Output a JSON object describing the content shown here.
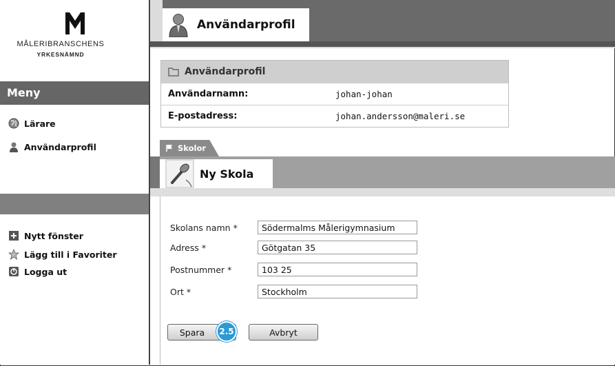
{
  "logo": {
    "line1": "MÅLERIBRANSCHENS",
    "line2": "YRKESNÄMND"
  },
  "sidebar": {
    "menu_title": "Meny",
    "items": [
      {
        "label": "Lärare",
        "icon": "globe-icon"
      },
      {
        "label": "Användarprofil",
        "icon": "user-icon"
      }
    ],
    "utility_items": [
      {
        "label": "Nytt fönster",
        "icon": "new-window-icon"
      },
      {
        "label": "Lägg till i Favoriter",
        "icon": "favorites-icon"
      },
      {
        "label": "Logga ut",
        "icon": "logout-icon"
      }
    ]
  },
  "header": {
    "title": "Användarprofil",
    "icon": "user-icon"
  },
  "profile": {
    "heading": "Användarprofil",
    "rows": [
      {
        "key": "Användarnamn:",
        "value": "johan-johan"
      },
      {
        "key": "E-postadress:",
        "value": "johan.andersson@maleri.se"
      }
    ]
  },
  "schools": {
    "tab_label": "Skolor",
    "section_title": "Ny Skola",
    "fields": [
      {
        "label": "Skolans namn *",
        "value": "Södermalms Målerigymnasium"
      },
      {
        "label": "Adress *",
        "value": "Götgatan 35"
      },
      {
        "label": "Postnummer *",
        "value": "103 25"
      },
      {
        "label": "Ort *",
        "value": "Stockholm"
      }
    ],
    "save_label": "Spara",
    "cancel_label": "Avbryt",
    "step_badge": "2.5"
  },
  "colors": {
    "accent": "#2c9ad6",
    "menu_bg": "#666666",
    "header_bg": "#6a6a6a"
  }
}
